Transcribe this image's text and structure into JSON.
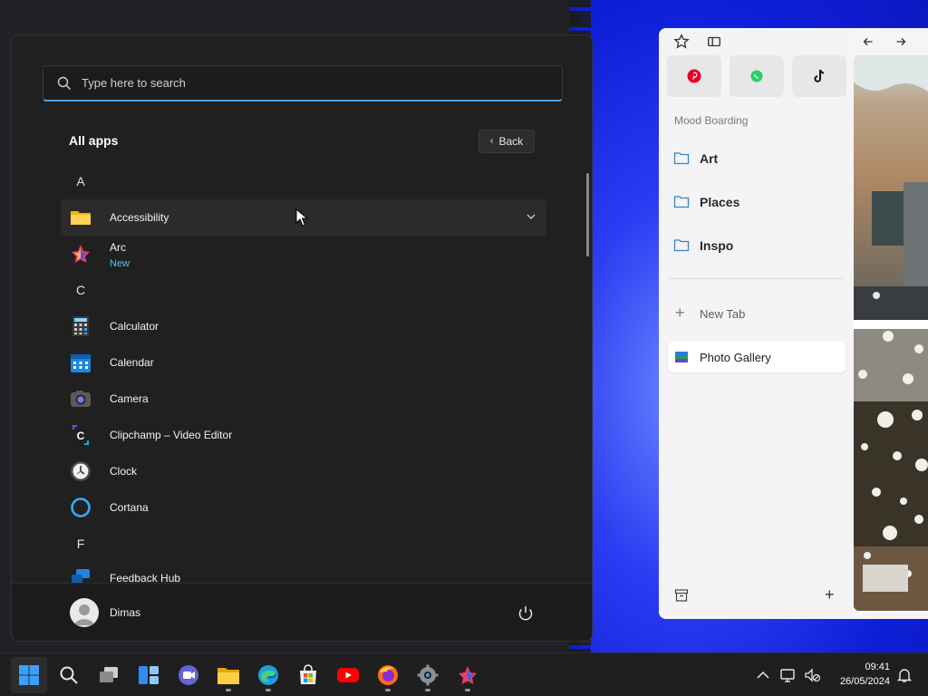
{
  "start_menu": {
    "search_placeholder": "Type here to search",
    "title": "All apps",
    "back_label": "Back",
    "sections": [
      {
        "letter": "A"
      },
      {
        "letter": "C"
      },
      {
        "letter": "F"
      }
    ],
    "apps": [
      {
        "name": "Accessibility",
        "icon": "folder-icon"
      },
      {
        "name": "Arc",
        "sub": "New",
        "icon": "arc-icon"
      },
      {
        "name": "Calculator",
        "icon": "calculator-icon"
      },
      {
        "name": "Calendar",
        "icon": "calendar-icon"
      },
      {
        "name": "Camera",
        "icon": "camera-icon"
      },
      {
        "name": "Clipchamp – Video Editor",
        "icon": "clipchamp-icon"
      },
      {
        "name": "Clock",
        "icon": "clock-icon"
      },
      {
        "name": "Cortana",
        "icon": "cortana-icon"
      },
      {
        "name": "Feedback Hub",
        "icon": "feedback-hub-icon"
      }
    ],
    "user_name": "Dimas"
  },
  "arc": {
    "pinned": [
      {
        "name": "Pinterest",
        "icon": "pinterest-icon",
        "color": "#e60023"
      },
      {
        "name": "WhatsApp",
        "icon": "whatsapp-icon",
        "color": "#25d366"
      },
      {
        "name": "TikTok",
        "icon": "tiktok-icon",
        "color": "#111111"
      }
    ],
    "space_title": "Mood Boarding",
    "folders": [
      {
        "label": "Art"
      },
      {
        "label": "Places"
      },
      {
        "label": "Inspo"
      }
    ],
    "new_tab_label": "New Tab",
    "active_tab_label": "Photo Gallery"
  },
  "taskbar": {
    "apps": [
      "start-icon",
      "search-icon",
      "task-view-icon",
      "widgets-icon",
      "teams-icon",
      "file-explorer-icon",
      "edge-icon",
      "store-icon",
      "youtube-icon",
      "firefox-icon",
      "settings-icon",
      "arc-icon"
    ],
    "time": "09:41",
    "date": "26/05/2024"
  },
  "colors": {
    "accent": "#4aa3e8",
    "new_badge": "#4cc2ff",
    "wallpaper_blue": "#0f1fd8"
  }
}
